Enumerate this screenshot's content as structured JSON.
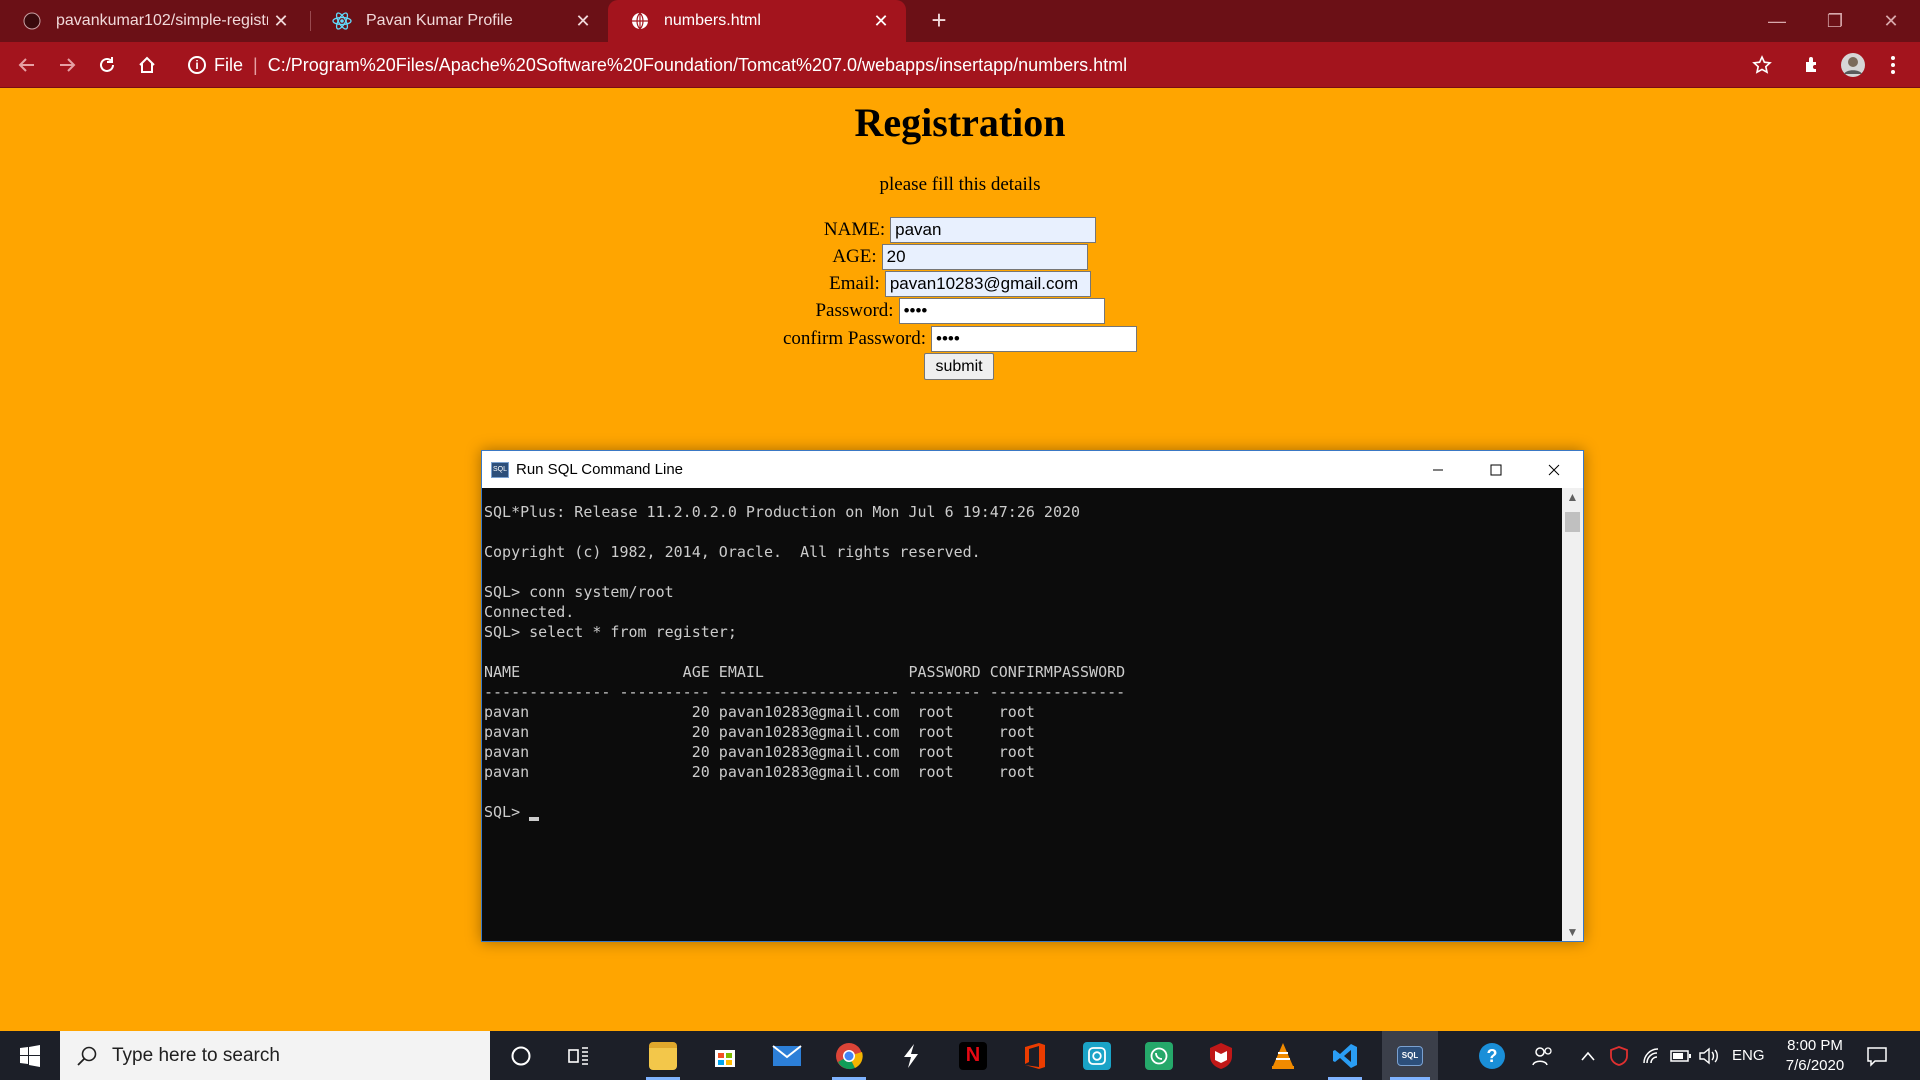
{
  "browser": {
    "tabs": [
      {
        "title": "pavankumar102/simple-registrat",
        "favicon": "github-icon"
      },
      {
        "title": "Pavan Kumar Profile",
        "favicon": "react-icon"
      },
      {
        "title": "numbers.html",
        "favicon": "globe-icon",
        "active": true
      }
    ],
    "address": {
      "scheme_label": "File",
      "url": "C:/Program%20Files/Apache%20Software%20Foundation/Tomcat%207.0/webapps/insertapp/numbers.html"
    },
    "theme_colors": {
      "tabstrip": "#6b1016",
      "toolbar": "#a3141d",
      "page_background": "#ffa500"
    }
  },
  "page": {
    "heading": "Registration",
    "subtitle": "please fill this details",
    "form": {
      "name_label": "NAME:",
      "name_value": "pavan",
      "age_label": "AGE:",
      "age_value": "20",
      "email_label": "Email:",
      "email_value": "pavan10283@gmail.com",
      "password_label": "Password:",
      "password_value": "root",
      "confirm_label": "confirm Password:",
      "confirm_value": "root",
      "submit_label": "submit"
    }
  },
  "console": {
    "title": "Run SQL Command Line",
    "lines": [
      "SQL*Plus: Release 11.2.0.2.0 Production on Mon Jul 6 19:47:26 2020",
      "",
      "Copyright (c) 1982, 2014, Oracle.  All rights reserved.",
      "",
      "SQL> conn system/root",
      "Connected.",
      "SQL> select * from register;",
      "",
      "NAME                  AGE EMAIL                PASSWORD CONFIRMPASSWORD",
      "-------------- ---------- -------------------- -------- ---------------",
      "pavan                  20 pavan10283@gmail.com  root     root",
      "pavan                  20 pavan10283@gmail.com  root     root",
      "pavan                  20 pavan10283@gmail.com  root     root",
      "pavan                  20 pavan10283@gmail.com  root     root",
      ""
    ],
    "prompt": "SQL> "
  },
  "taskbar": {
    "search_placeholder": "Type here to search",
    "apps": [
      "file-explorer-icon",
      "store-icon",
      "mail-icon",
      "chrome-icon",
      "swift-icon",
      "netflix-icon",
      "office-icon",
      "instagram-icon",
      "whatsapp-icon",
      "mcafee-icon",
      "vlc-icon",
      "vscode-icon",
      "sql-console-icon"
    ],
    "language": "ENG",
    "time": "8:00 PM",
    "date": "7/6/2020"
  }
}
